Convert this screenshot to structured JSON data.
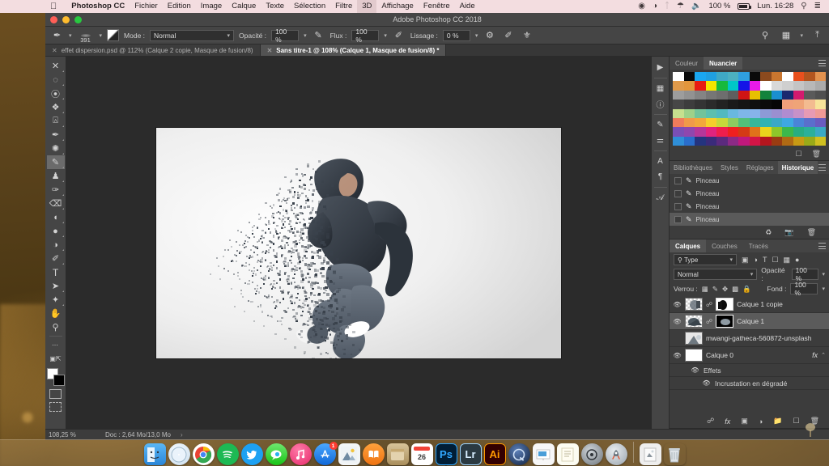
{
  "menubar": {
    "apple_icon": "apple-icon",
    "app_name": "Photoshop CC",
    "items": [
      "Fichier",
      "Edition",
      "Image",
      "Calque",
      "Texte",
      "Sélection",
      "Filtre",
      "3D",
      "Affichage",
      "Fenêtre",
      "Aide"
    ],
    "status": {
      "record_icon": "record-icon",
      "dnd_icon": "do-not-disturb-icon",
      "bluetooth_icon": "bluetooth-icon",
      "wifi_icon": "wifi-icon",
      "volume_icon": "volume-icon",
      "battery_percent": "100 %",
      "battery_icon": "battery-icon",
      "clock": "Lun. 16:28",
      "search_icon": "search-icon",
      "control_center_icon": "list-icon"
    }
  },
  "window": {
    "title": "Adobe Photoshop CC 2018",
    "close_label": "close",
    "minimize_label": "minimize",
    "zoom_label": "zoom"
  },
  "options_bar": {
    "tool_icon": "brush-icon",
    "brush_size": "391",
    "preset_icon": "brush-preset-icon",
    "mode_label": "Mode :",
    "mode_value": "Normal",
    "opacity_label": "Opacité :",
    "opacity_value": "100 %",
    "opacity_pressure_icon": "pressure-opacity-icon",
    "flow_label": "Flux :",
    "flow_value": "100 %",
    "airbrush_icon": "airbrush-icon",
    "smoothing_label": "Lissage :",
    "smoothing_value": "0 %",
    "smoothing_options_icon": "gear-icon",
    "pressure_size_icon": "pressure-size-icon",
    "symmetry_icon": "symmetry-icon",
    "search_icon": "search-icon",
    "workspace_icon": "workspace-icon",
    "share_icon": "share-icon"
  },
  "document_tabs": [
    {
      "title": "effet dispersion.psd @ 112% (Calque 2 copie, Masque de fusion/8)",
      "active": false,
      "close_icon": "close-icon"
    },
    {
      "title": "Sans titre-1 @ 108% (Calque 1, Masque de fusion/8) *",
      "active": true,
      "close_icon": "close-icon"
    }
  ],
  "toolbar": {
    "tools": [
      {
        "name": "move-tool",
        "glyph": "✥",
        "active": false
      },
      {
        "name": "marquee-tool",
        "glyph": "◌",
        "active": false
      },
      {
        "name": "lasso-tool",
        "glyph": "◯",
        "active": false
      },
      {
        "name": "quick-selection-tool",
        "glyph": "❧",
        "active": false
      },
      {
        "name": "crop-tool",
        "glyph": "⌗",
        "active": false
      },
      {
        "name": "eyedropper-tool",
        "glyph": "✐",
        "active": false
      },
      {
        "name": "healing-brush-tool",
        "glyph": "✺",
        "active": false
      },
      {
        "name": "brush-tool",
        "glyph": "✎",
        "active": true
      },
      {
        "name": "clone-stamp-tool",
        "glyph": "♟",
        "active": false
      },
      {
        "name": "history-brush-tool",
        "glyph": "✍",
        "active": false
      },
      {
        "name": "eraser-tool",
        "glyph": "⌫",
        "active": false
      },
      {
        "name": "gradient-tool",
        "glyph": "◨",
        "active": false
      },
      {
        "name": "blur-tool",
        "glyph": "💧",
        "active": false
      },
      {
        "name": "dodge-tool",
        "glyph": "◕",
        "active": false
      },
      {
        "name": "pen-tool",
        "glyph": "✒",
        "active": false
      },
      {
        "name": "type-tool",
        "glyph": "T",
        "active": false
      },
      {
        "name": "path-selection-tool",
        "glyph": "➤",
        "active": false
      },
      {
        "name": "shape-tool",
        "glyph": "✧",
        "active": false
      },
      {
        "name": "hand-tool",
        "glyph": "✋",
        "active": false
      },
      {
        "name": "zoom-tool",
        "glyph": "🔍",
        "active": false
      },
      {
        "name": "edit-toolbar-more",
        "glyph": "•••",
        "active": false
      }
    ],
    "foreground_color": "#ffffff",
    "background_color": "#000000",
    "quick-mask-icon": "quick-mask-icon",
    "screen-mode-icon": "screen-mode-icon"
  },
  "canvas": {
    "artwork_title": "dispersion effect of jumping man",
    "background_color": "#f2f2f2"
  },
  "statusbar": {
    "zoom": "108,25 %",
    "doc_info": "Doc : 2,64 Mo/13,0 Mo",
    "expand_arrow": "›"
  },
  "right_rail": [
    {
      "name": "expand-panels-icon",
      "glyph": "▶"
    },
    {
      "name": "color-libraries-icon",
      "glyph": "▦"
    },
    {
      "name": "info-icon",
      "glyph": "ⓘ"
    },
    {
      "name": "brush-settings-icon",
      "glyph": "✎"
    },
    {
      "name": "adjustments-icon",
      "glyph": "⚌"
    },
    {
      "name": "character-icon",
      "glyph": "A"
    },
    {
      "name": "paragraph-icon",
      "glyph": "¶"
    },
    {
      "name": "glyphs-icon",
      "glyph": "𝒜"
    }
  ],
  "color_panel": {
    "tabs": [
      {
        "label": "Couleur",
        "active": false
      },
      {
        "label": "Nuancier",
        "active": true
      }
    ],
    "menu_icon": "panel-menu-icon",
    "swatch_rows": [
      [
        "#ffffff",
        "#0a0a0a",
        "#1aa7f0",
        "#1f9fe0",
        "#3fa8c4",
        "#4cb0c0",
        "#2f9fe0",
        "#0a0a0a",
        "#8c4a1e",
        "#c9762f",
        "#ffffff",
        "#e8501e",
        "#b2551f",
        "#e2924f",
        "#e09a4a",
        "#e3963c"
      ],
      [
        "#e81b12",
        "#f5e500",
        "#17b93c",
        "#00c7c7",
        "#1414e8",
        "#e81ae8",
        "#ffffff",
        "#d8d8d8",
        "#cfcfcf",
        "#c4c4c4",
        "#b8b8b8",
        "#ababab",
        "#9d9d9d",
        "#929292",
        "#848484",
        "#767676"
      ],
      [
        "#6e6e6e",
        "#5e5e5e",
        "#d01414",
        "#e8c000",
        "#13833c",
        "#1a8fd0",
        "#1a2a70",
        "#d41a6e",
        "#5a5a5a",
        "#505050",
        "#474747",
        "#3d3d3d",
        "#343434",
        "#2b2b2b",
        "#222222",
        "#1a1a1a"
      ],
      [
        "#151515",
        "#101010",
        "#0b0b0b",
        "#060606",
        "#f0a07a",
        "#efa478",
        "#f3bb90",
        "#f7e39a",
        "#c7e08e",
        "#9ed189",
        "#72c39a",
        "#5dbfae",
        "#52b9c0",
        "#69b8e0",
        "#7fb6e8",
        "#86b3ea"
      ],
      [
        "#8d9ad6",
        "#9a8fd0",
        "#b08cd0",
        "#c891c8",
        "#e79ab4",
        "#ef9a96",
        "#ef7c5c",
        "#f09a4a",
        "#f2a83c",
        "#f5cf2c",
        "#c6d93a",
        "#8ccc60",
        "#52bf7a",
        "#36b79a",
        "#2fb3b3",
        "#3aa8c6"
      ],
      [
        "#3ea8e2",
        "#4a84d8",
        "#5a6fcc",
        "#6a5cc0",
        "#7a4fb6",
        "#8f47ae",
        "#b5379a",
        "#e0247e",
        "#f01e4c",
        "#ef2020",
        "#d43a14",
        "#e0721a",
        "#ead41c",
        "#8ec72a",
        "#3cb84c",
        "#28ad82"
      ],
      [
        "#2bb09a",
        "#3aa9c4",
        "#2f8fd8",
        "#2a6ecc",
        "#24347f",
        "#3a2b7a",
        "#5b2a7e",
        "#8c2a86",
        "#c0187c",
        "#d41446",
        "#b4161e",
        "#9a3c12",
        "#b06a14",
        "#c89a14",
        "#9aaa18",
        "#d0c020"
      ]
    ],
    "footer": {
      "new_swatch_icon": "new-swatch-icon",
      "delete_swatch_icon": "trash-icon"
    }
  },
  "history_panel": {
    "tabs": [
      {
        "label": "Bibliothèques",
        "active": false
      },
      {
        "label": "Styles",
        "active": false
      },
      {
        "label": "Réglages",
        "active": false
      },
      {
        "label": "Historique",
        "active": true
      }
    ],
    "menu_icon": "panel-menu-icon",
    "states": [
      {
        "label": "Pinceau",
        "icon": "brush-icon",
        "selected": false
      },
      {
        "label": "Pinceau",
        "icon": "brush-icon",
        "selected": false
      },
      {
        "label": "Pinceau",
        "icon": "brush-icon",
        "selected": false
      },
      {
        "label": "Pinceau",
        "icon": "brush-icon",
        "selected": true
      }
    ],
    "footer": {
      "create_document_icon": "new-document-icon",
      "snapshot_icon": "camera-icon",
      "delete_icon": "trash-icon"
    }
  },
  "layers_panel": {
    "tabs": [
      {
        "label": "Calques",
        "active": true
      },
      {
        "label": "Couches",
        "active": false
      },
      {
        "label": "Tracés",
        "active": false
      }
    ],
    "menu_icon": "panel-menu-icon",
    "filter": {
      "label": "Type",
      "search_icon": "search-icon",
      "chevron_icon": "chevron-down-icon",
      "filter_icons": [
        "pixel-filter-icon",
        "adjustment-filter-icon",
        "type-filter-icon",
        "shape-filter-icon",
        "smart-object-filter-icon"
      ],
      "toggle_icon": "filter-toggle-icon"
    },
    "blend_mode": "Normal",
    "opacity_label": "Opacité :",
    "opacity_value": "100 %",
    "lock_label": "Verrou :",
    "lock_icons": [
      "lock-transparent-icon",
      "lock-image-icon",
      "lock-position-icon",
      "lock-artboard-icon",
      "lock-all-icon"
    ],
    "fill_label": "Fond :",
    "fill_value": "100 %",
    "layers": [
      {
        "name": "Calque 1 copie",
        "visible": true,
        "selected": false,
        "has_mask": true,
        "linked": true,
        "mask_kind": "dark"
      },
      {
        "name": "Calque 1",
        "visible": true,
        "selected": true,
        "has_mask": true,
        "linked": true,
        "mask_kind": "dark"
      },
      {
        "name": "mwangi-gatheca-560872-unsplash",
        "visible": false,
        "selected": false,
        "has_mask": false,
        "linked": false,
        "mask_kind": "none"
      },
      {
        "name": "Calque 0",
        "visible": true,
        "selected": false,
        "has_mask": false,
        "linked": false,
        "mask_kind": "none",
        "fx": "fx",
        "chevron": "⌃"
      }
    ],
    "effects": {
      "group_label": "Effets",
      "items": [
        {
          "label": "Incrustation en dégradé",
          "visible": true
        }
      ],
      "visible": true
    },
    "footer": {
      "link_icon": "link-icon",
      "fx_icon": "fx-icon",
      "mask_icon": "add-mask-icon",
      "adjustment_icon": "new-adjustment-icon",
      "group_icon": "new-group-icon",
      "new_layer_icon": "new-layer-icon",
      "delete_icon": "trash-icon"
    }
  },
  "dock": {
    "apps": [
      {
        "name": "finder",
        "label": "",
        "color": "#3b9bed",
        "running": true
      },
      {
        "name": "safari",
        "label": "",
        "color": "#f0f4f8",
        "running": true
      },
      {
        "name": "chrome",
        "label": "",
        "color": "#f4f4f4",
        "running": true
      },
      {
        "name": "spotify",
        "label": "",
        "color": "#1db954",
        "running": false
      },
      {
        "name": "twitter",
        "label": "",
        "color": "#1da1f2",
        "running": false
      },
      {
        "name": "messages",
        "label": "",
        "color": "#4cd964",
        "running": false
      },
      {
        "name": "itunes",
        "label": "",
        "color": "#fc3c6e",
        "running": false
      },
      {
        "name": "app-store",
        "label": "",
        "color": "#2b8cf0",
        "running": false,
        "badge": "1"
      },
      {
        "name": "photos",
        "label": "",
        "color": "#eef1f4",
        "running": false
      },
      {
        "name": "books",
        "label": "",
        "color": "#f58220",
        "running": false
      },
      {
        "name": "notes-app",
        "label": "",
        "color": "#d8bd8a",
        "running": false
      },
      {
        "name": "calendar",
        "label": "26",
        "color": "#ffffff",
        "running": false
      },
      {
        "name": "photoshop",
        "label": "Ps",
        "color": "#001e36",
        "running": true
      },
      {
        "name": "lightroom",
        "label": "Lr",
        "color": "#2b3a42",
        "running": false
      },
      {
        "name": "illustrator",
        "label": "Ai",
        "color": "#330000",
        "running": false
      },
      {
        "name": "quicktime",
        "label": "",
        "color": "#1a1a2e",
        "running": true
      },
      {
        "name": "keynote",
        "label": "",
        "color": "#f2f2f2",
        "running": false
      },
      {
        "name": "pages",
        "label": "",
        "color": "#fbfbf0",
        "running": false
      },
      {
        "name": "system-preferences",
        "label": "",
        "color": "#8d8d8d",
        "running": false
      },
      {
        "name": "launchpad",
        "label": "",
        "color": "#c6ccd2",
        "running": false
      }
    ],
    "trash_items": [
      {
        "name": "recent-document",
        "label": "",
        "color": "#e8e8e8"
      },
      {
        "name": "trash",
        "label": "",
        "color": "#d9dde0"
      }
    ]
  }
}
